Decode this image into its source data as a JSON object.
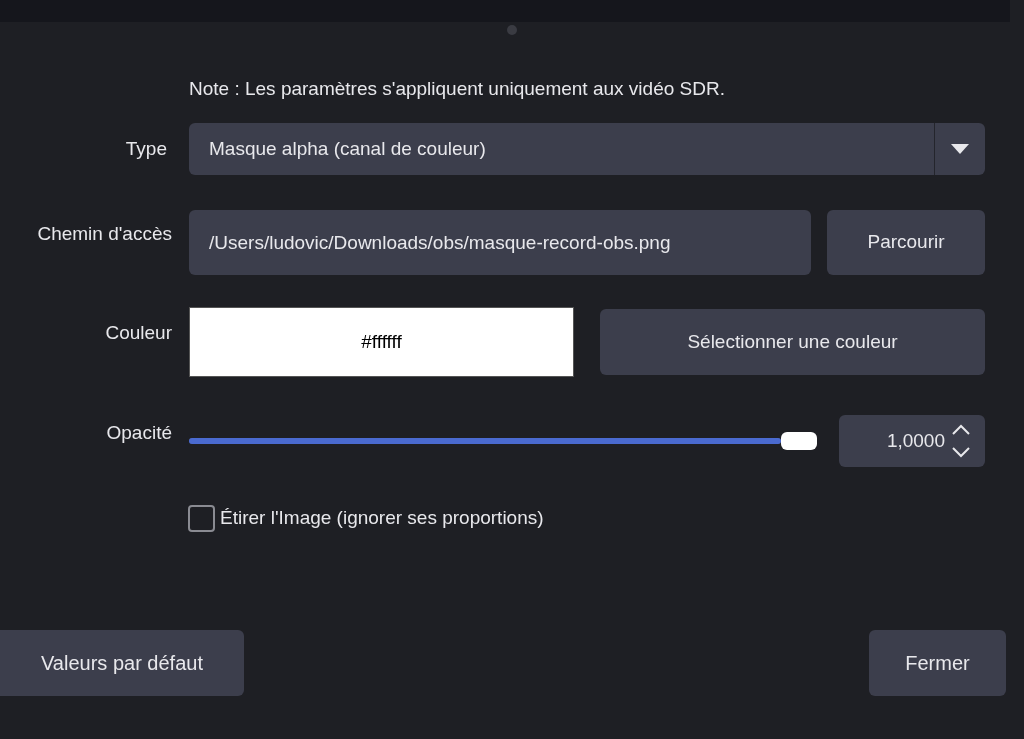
{
  "note": "Note : Les paramètres s'appliquent uniquement aux vidéo SDR.",
  "type": {
    "label": "Type",
    "value": "Masque alpha (canal de couleur)"
  },
  "path": {
    "label": "Chemin d'accès",
    "value": "/Users/ludovic/Downloads/obs/masque-record-obs.png",
    "button": "Parcourir"
  },
  "color": {
    "label": "Couleur",
    "value": "#ffffff",
    "button": "Sélectionner une couleur"
  },
  "opacity": {
    "label": "Opacité",
    "level": 1,
    "value": "1,0000"
  },
  "stretch": {
    "label": "Étirer l'Image (ignorer ses proportions)",
    "checked": false
  },
  "buttons": {
    "defaults": "Valeurs par défaut",
    "close": "Fermer"
  }
}
